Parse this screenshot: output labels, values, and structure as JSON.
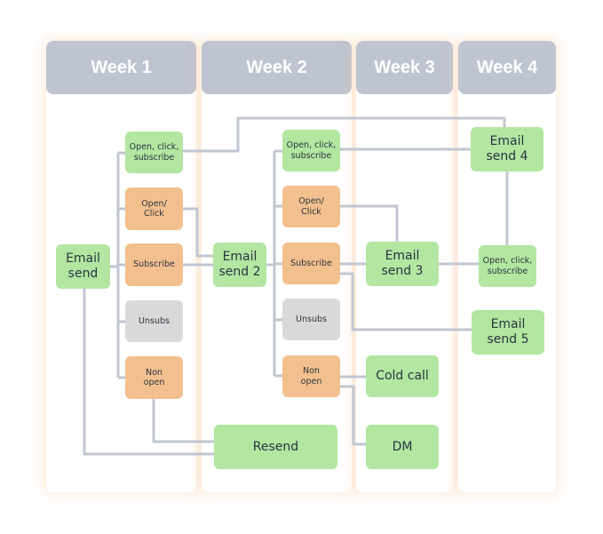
{
  "weeks": [
    "Week 1",
    "Week 2",
    "Week 3",
    "Week 4"
  ],
  "nodes": {
    "email_send": "Email\nsend",
    "w1_open_click_subscribe": "Open, click,\nsubscribe",
    "w1_open_click": "Open/\nClick",
    "w1_subscribe": "Subscribe",
    "w1_unsubs": "Unsubs",
    "w1_non_open": "Non\nopen",
    "email_send_2": "Email\nsend 2",
    "w2_open_click_subscribe": "Open, click,\nsubscribe",
    "w2_open_click": "Open/\nClick",
    "w2_subscribe": "Subscribe",
    "w2_unsubs": "Unsubs",
    "w2_non_open": "Non\nopen",
    "resend": "Resend",
    "email_send_3": "Email\nsend 3",
    "cold_call": "Cold call",
    "dm": "DM",
    "email_send_4": "Email\nsend 4",
    "w4_open_click_subscribe": "Open, click,\nsubscribe",
    "email_send_5": "Email\nsend 5"
  },
  "colors": {
    "header": "#bec4d0",
    "positive": "#b2e6a1",
    "neutral": "#f2c08e",
    "unsubscribed": "#d9d9d9",
    "connector": "#c0c6d2"
  }
}
